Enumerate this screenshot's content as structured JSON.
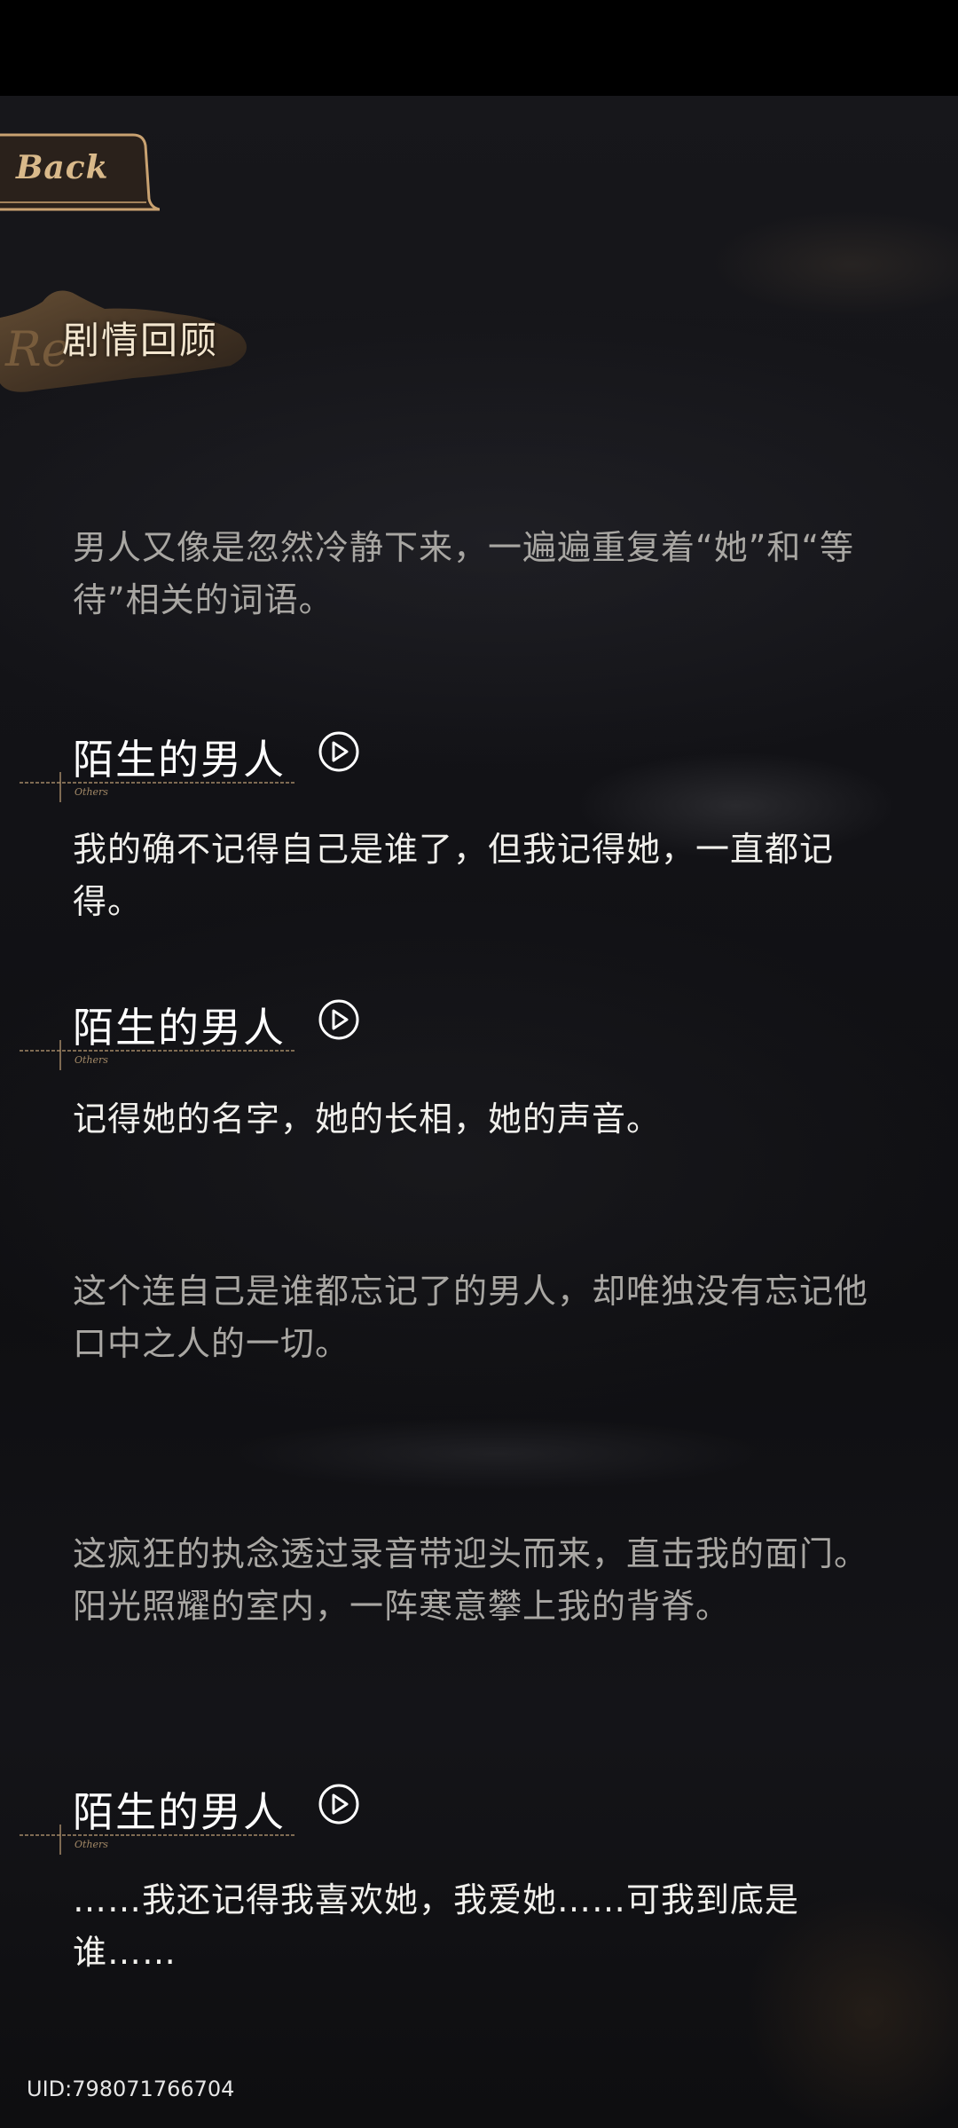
{
  "back_button": {
    "label": "Back"
  },
  "section": {
    "title": "剧情回顾"
  },
  "entries": [
    {
      "type": "narration",
      "text": "男人又像是忽然冷静下来，一遍遍重复着“她”和“等待”相关的词语。"
    },
    {
      "type": "dialogue",
      "speaker": "陌生的男人",
      "speaker_tag": "Others",
      "text": "我的确不记得自己是谁了，但我记得她，一直都记得。"
    },
    {
      "type": "dialogue",
      "speaker": "陌生的男人",
      "speaker_tag": "Others",
      "text": "记得她的名字，她的长相，她的声音。"
    },
    {
      "type": "narration",
      "text": "这个连自己是谁都忘记了的男人，却唯独没有忘记他口中之人的一切。"
    },
    {
      "type": "narration",
      "text": "这疯狂的执念透过录音带迎头而来，直击我的面门。阳光照耀的室内，一阵寒意攀上我的背脊。"
    },
    {
      "type": "dialogue",
      "speaker": "陌生的男人",
      "speaker_tag": "Others",
      "text": "……我还记得我喜欢她，我爱她……可我到底是谁……"
    }
  ],
  "footer": {
    "uid": "UID:798071766704"
  },
  "colors": {
    "accent_gold": "#d9b98a",
    "narration_text": "#a9a7a3",
    "dialogue_text": "#f1f0ec",
    "background": "#121216"
  },
  "icons": {
    "voice": "play-voice-icon"
  }
}
